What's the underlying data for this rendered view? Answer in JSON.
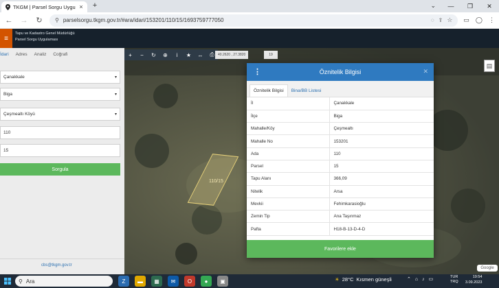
{
  "browser": {
    "tab_title": "TKGM | Parsel Sorgu Uygulaması",
    "url": "parselsorgu.tkgm.gov.tr/#ara/idari/153201/110/15/1693759777050"
  },
  "app": {
    "org_line1": "Tapu ve Kadastro Genel Müdürlüğü",
    "org_line2": "Parsel Sorgu Uygulaması"
  },
  "left_panel": {
    "tabs": [
      "İdari",
      "Adres",
      "Analiz",
      "Coğrafi"
    ],
    "il": "Çanakkale",
    "ilce": "Biga",
    "mahalle": "Çeşmealtı Köyü",
    "ada": "110",
    "parsel": "15",
    "query_button": "Sorgula",
    "email": "cbs@tkgm.gov.tr"
  },
  "map": {
    "coordinates": "40.2620 , 27.3820",
    "zoom": "19",
    "parcel_label": "110/15",
    "attribution": "Google"
  },
  "modal": {
    "title": "Öznitelik Bilgisi",
    "tabs": [
      "Öznitelik Bilgisi",
      "Bina/BB Listesi"
    ],
    "rows": [
      {
        "key": "İl",
        "value": "Çanakkale"
      },
      {
        "key": "İlçe",
        "value": "Biga"
      },
      {
        "key": "Mahalle/Köy",
        "value": "Çeşmealtı"
      },
      {
        "key": "Mahalle No",
        "value": "153201"
      },
      {
        "key": "Ada",
        "value": "110"
      },
      {
        "key": "Parsel",
        "value": "15"
      },
      {
        "key": "Tapu Alanı",
        "value": "366,09"
      },
      {
        "key": "Nitelik",
        "value": "Arsa"
      },
      {
        "key": "Mevkii",
        "value": "Fehimkarasioğlu"
      },
      {
        "key": "Zemin Tip",
        "value": "Ana Taşınmaz"
      },
      {
        "key": "Pafta",
        "value": "H18-B-13-D-4-D"
      }
    ],
    "favorite_button": "Favorilere ekle"
  },
  "taskbar": {
    "search_placeholder": "Ara",
    "weather_temp": "28°C",
    "weather_desc": "Kısmen güneşli",
    "lang1": "TUR",
    "lang2": "TRQ",
    "time": "19:54",
    "date": "3.09.2023"
  },
  "colors": {
    "header_bg": "#16212c",
    "accent_orange": "#d35400",
    "modal_blue": "#2f7ac0",
    "green_button": "#5cb85c"
  }
}
